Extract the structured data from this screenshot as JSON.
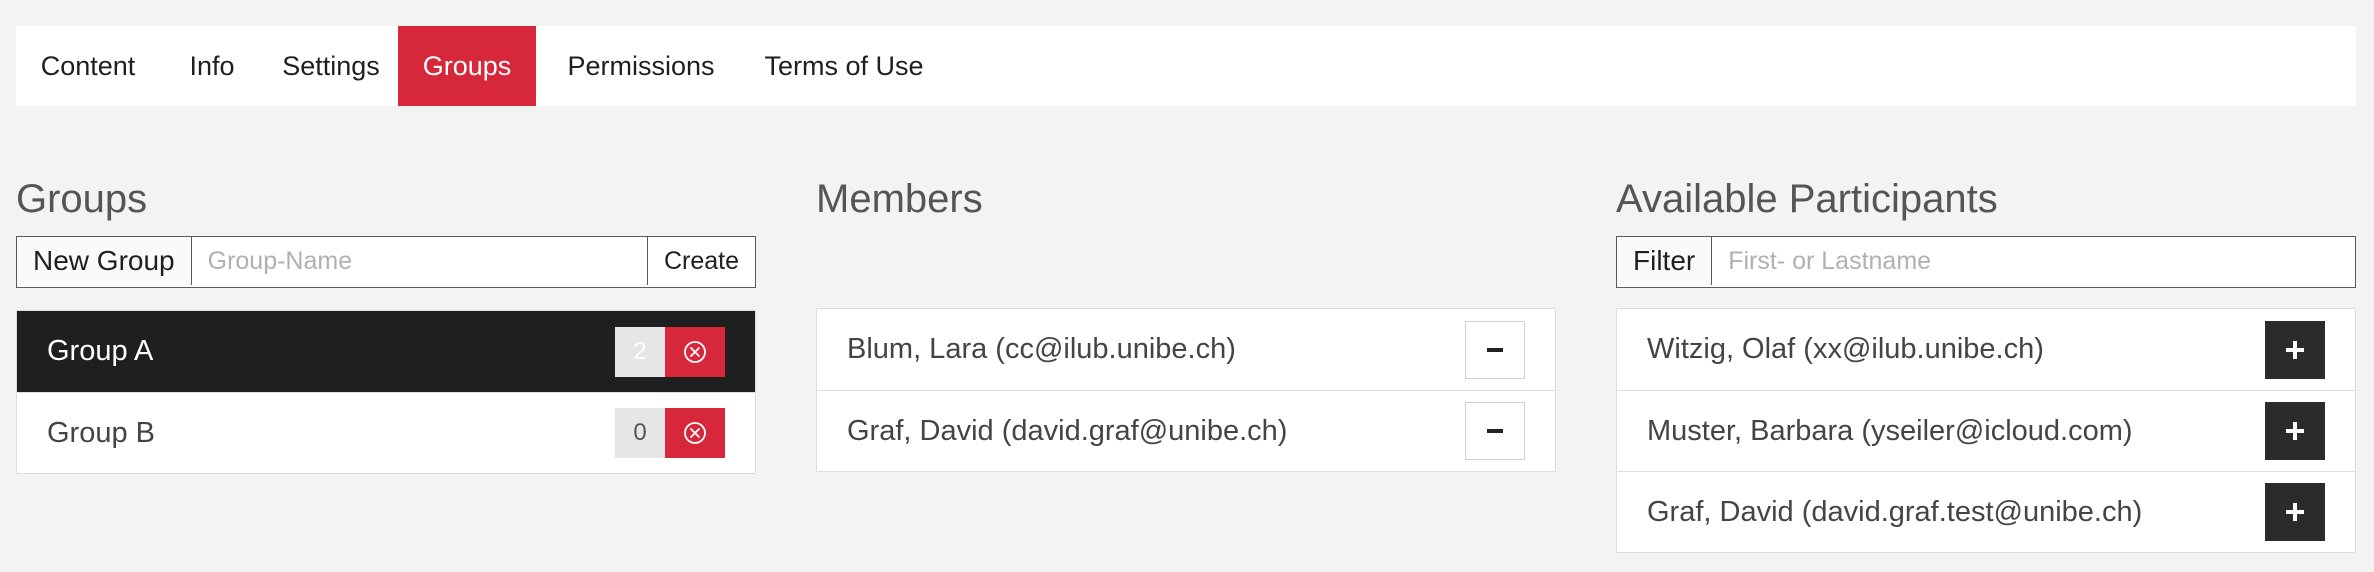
{
  "tabs": [
    {
      "label": "Content",
      "active": false
    },
    {
      "label": "Info",
      "active": false
    },
    {
      "label": "Settings",
      "active": false
    },
    {
      "label": "Groups",
      "active": true
    },
    {
      "label": "Permissions",
      "active": false
    },
    {
      "label": "Terms of Use",
      "active": false
    }
  ],
  "groups_panel": {
    "title": "Groups",
    "new_group_label": "New Group",
    "group_name_placeholder": "Group-Name",
    "create_label": "Create",
    "items": [
      {
        "name": "Group A",
        "count": "2",
        "selected": true
      },
      {
        "name": "Group B",
        "count": "0",
        "selected": false
      }
    ]
  },
  "members_panel": {
    "title": "Members",
    "items": [
      {
        "name": "Blum, Lara (cc@ilub.unibe.ch)"
      },
      {
        "name": "Graf, David (david.graf@unibe.ch)"
      }
    ]
  },
  "available_panel": {
    "title": "Available Participants",
    "filter_label": "Filter",
    "filter_placeholder": "First- or Lastname",
    "items": [
      {
        "name": "Witzig, Olaf (xx@ilub.unibe.ch)"
      },
      {
        "name": "Muster, Barbara (yseiler@icloud.com)"
      },
      {
        "name": "Graf, David (david.graf.test@unibe.ch)"
      }
    ]
  },
  "colors": {
    "accent": "#d6283a",
    "selected_row": "#1f1f1f",
    "add_button": "#2b2b2b"
  }
}
